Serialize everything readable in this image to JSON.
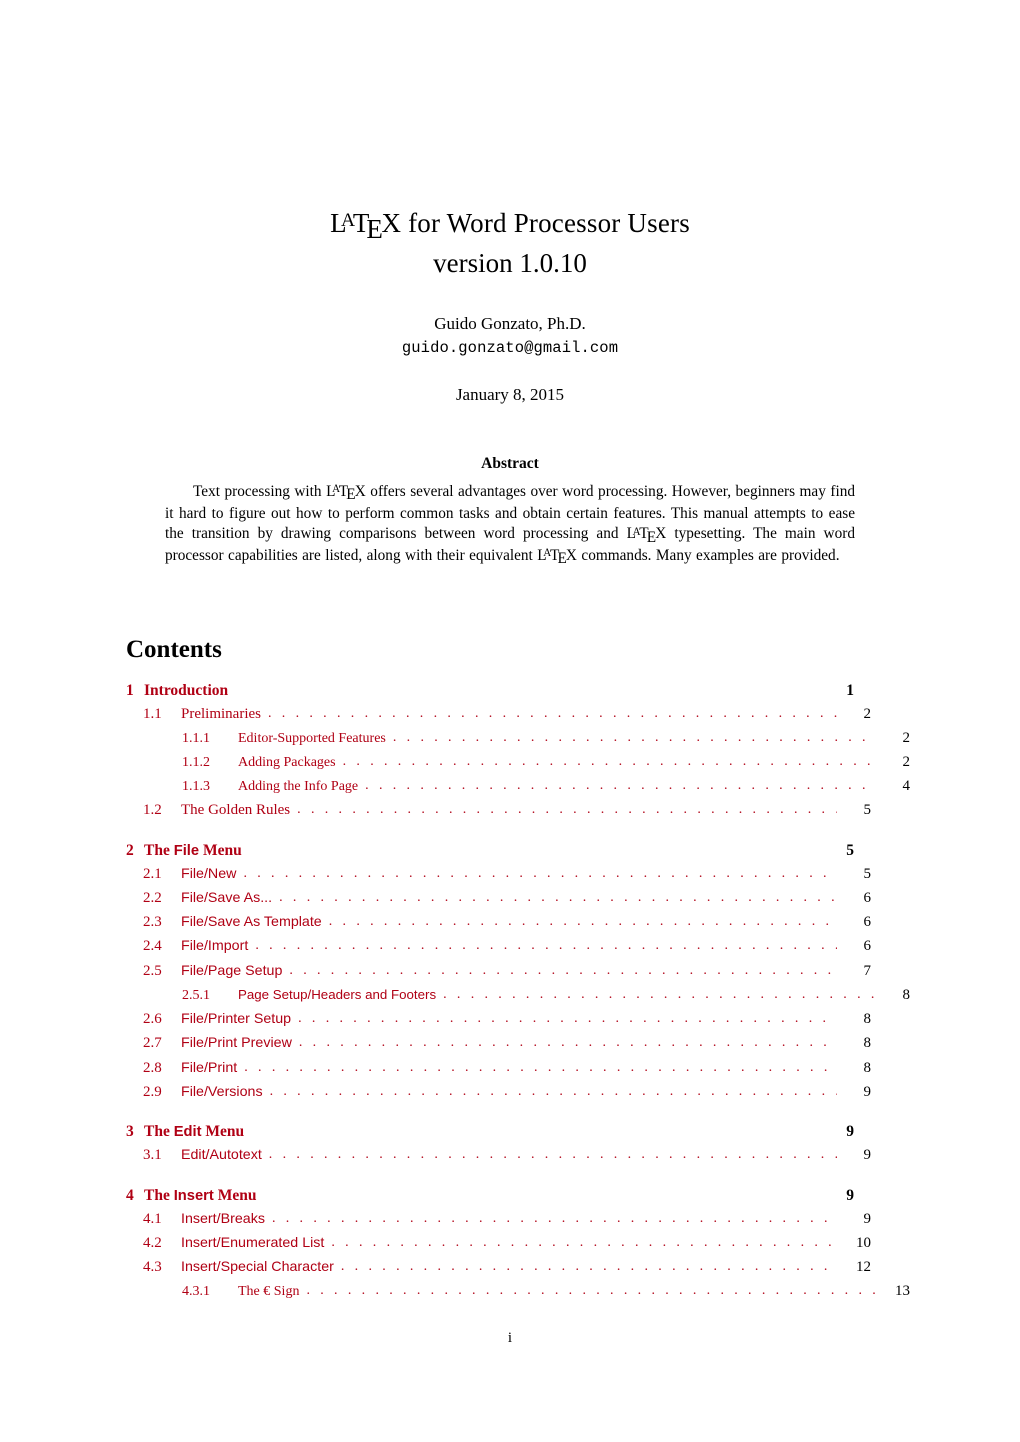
{
  "document": {
    "title_prefix_latex": "LaTeX",
    "title_rest": " for Word Processor Users",
    "subtitle": "version 1.0.10",
    "author": "Guido Gonzato, Ph.D.",
    "email": "guido.gonzato@gmail.com",
    "date": "January 8, 2015",
    "folio": "i"
  },
  "abstract": {
    "heading": "Abstract",
    "paragraph_part1": "Text processing with ",
    "paragraph_part2": " offers several advantages over word processing. However, beginners may find it hard to figure out how to perform common tasks and obtain certain features. This manual attempts to ease the transition by drawing comparisons between word processing and ",
    "paragraph_part3": " typesetting. The main word processor capabilities are listed, along with their equivalent ",
    "paragraph_part4": " commands. Many examples are provided."
  },
  "contents": {
    "heading": "Contents",
    "entries": [
      {
        "level": 1,
        "number": "1",
        "title": "Introduction",
        "title_style": "serif",
        "page": "1",
        "gap_before": false
      },
      {
        "level": 2,
        "number": "1.1",
        "title": "Preliminaries",
        "title_style": "serif",
        "page": "2",
        "gap_before": false
      },
      {
        "level": 3,
        "number": "1.1.1",
        "title": "Editor-Supported Features",
        "title_style": "serif",
        "page": "2",
        "gap_before": false
      },
      {
        "level": 3,
        "number": "1.1.2",
        "title": "Adding Packages",
        "title_style": "serif",
        "page": "2",
        "gap_before": false
      },
      {
        "level": 3,
        "number": "1.1.3",
        "title": "Adding the Info Page",
        "title_style": "serif",
        "page": "4",
        "gap_before": false
      },
      {
        "level": 2,
        "number": "1.2",
        "title": "The Golden Rules",
        "title_style": "serif",
        "page": "5",
        "gap_before": false
      },
      {
        "level": 1,
        "number": "2",
        "title_pre": "The ",
        "title_sf": "File",
        "title_post": " Menu",
        "title_style": "mixed",
        "page": "5",
        "gap_before": true
      },
      {
        "level": 2,
        "number": "2.1",
        "title": "File/New",
        "title_style": "sans",
        "page": "5",
        "gap_before": false
      },
      {
        "level": 2,
        "number": "2.2",
        "title": "File/Save As...",
        "title_style": "sans",
        "page": "6",
        "gap_before": false
      },
      {
        "level": 2,
        "number": "2.3",
        "title": "File/Save As Template",
        "title_style": "sans",
        "page": "6",
        "gap_before": false
      },
      {
        "level": 2,
        "number": "2.4",
        "title": "File/Import",
        "title_style": "sans",
        "page": "6",
        "gap_before": false
      },
      {
        "level": 2,
        "number": "2.5",
        "title": "File/Page Setup",
        "title_style": "sans",
        "page": "7",
        "gap_before": false
      },
      {
        "level": 3,
        "number": "2.5.1",
        "title": "Page Setup/Headers and Footers",
        "title_style": "sans",
        "page": "8",
        "gap_before": false
      },
      {
        "level": 2,
        "number": "2.6",
        "title": "File/Printer Setup",
        "title_style": "sans",
        "page": "8",
        "gap_before": false
      },
      {
        "level": 2,
        "number": "2.7",
        "title": "File/Print Preview",
        "title_style": "sans",
        "page": "8",
        "gap_before": false
      },
      {
        "level": 2,
        "number": "2.8",
        "title": "File/Print",
        "title_style": "sans",
        "page": "8",
        "gap_before": false
      },
      {
        "level": 2,
        "number": "2.9",
        "title": "File/Versions",
        "title_style": "sans",
        "page": "9",
        "gap_before": false
      },
      {
        "level": 1,
        "number": "3",
        "title_pre": "The ",
        "title_sf": "Edit",
        "title_post": " Menu",
        "title_style": "mixed",
        "page": "9",
        "gap_before": true
      },
      {
        "level": 2,
        "number": "3.1",
        "title": "Edit/Autotext",
        "title_style": "sans",
        "page": "9",
        "gap_before": false
      },
      {
        "level": 1,
        "number": "4",
        "title_pre": "The ",
        "title_sf": "Insert",
        "title_post": " Menu",
        "title_style": "mixed",
        "page": "9",
        "gap_before": true
      },
      {
        "level": 2,
        "number": "4.1",
        "title": "Insert/Breaks",
        "title_style": "sans",
        "page": "9",
        "gap_before": false
      },
      {
        "level": 2,
        "number": "4.2",
        "title": "Insert/Enumerated List",
        "title_style": "sans",
        "page": "10",
        "gap_before": false
      },
      {
        "level": 2,
        "number": "4.3",
        "title": "Insert/Special Character",
        "title_style": "sans",
        "page": "12",
        "gap_before": false
      },
      {
        "level": 3,
        "number": "4.3.1",
        "title": "The € Sign",
        "title_style": "serif",
        "page": "13",
        "gap_before": false
      }
    ]
  },
  "colors": {
    "link_red": "#b00014",
    "text_black": "#000000",
    "page_background": "#ffffff"
  }
}
